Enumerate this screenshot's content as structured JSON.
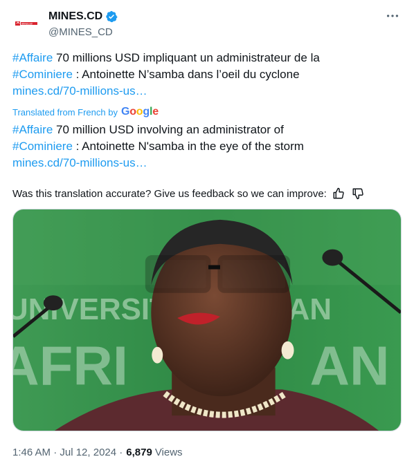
{
  "author": {
    "name": "MINES.CD",
    "handle": "@MINES_CD",
    "avatar_text": "mines.cd"
  },
  "tweet": {
    "original": {
      "tag1": "#Affaire",
      "text1": " 70 millions USD impliquant un administrateur de la ",
      "tag2": "#Cominiere",
      "text2": " : Antoinette N’samba dans l’oeil du cyclone",
      "link": "mines.cd/70-millions-us…"
    },
    "translated_by": "Translated from French by",
    "translator_brand": [
      "G",
      "o",
      "o",
      "g",
      "l",
      "e"
    ],
    "translation": {
      "tag1": "#Affaire",
      "text1": " 70 million USD involving an administrator of ",
      "tag2": "#Cominiere",
      "text2": " : Antoinette N'samba in the eye of the storm",
      "link": "mines.cd/70-millions-us…"
    },
    "feedback_prompt": "Was this translation accurate? Give us feedback so we can improve:",
    "time": "1:46 AM · Jul 12, 2024 · ",
    "views_count": "6,879",
    "views_label": "Views"
  },
  "media": {
    "background_text": "UNIVERSITY AFRICAN"
  },
  "colors": {
    "accent": "#1d9bf0",
    "secondary_text": "#536471",
    "primary_text": "#0f1419",
    "logo_red": "#d9232e",
    "media_green": "#2d8a45"
  },
  "icons": {
    "verified": "verified-badge-icon",
    "more": "more-options-icon",
    "thumbs_up": "thumbs-up-icon",
    "thumbs_down": "thumbs-down-icon"
  }
}
